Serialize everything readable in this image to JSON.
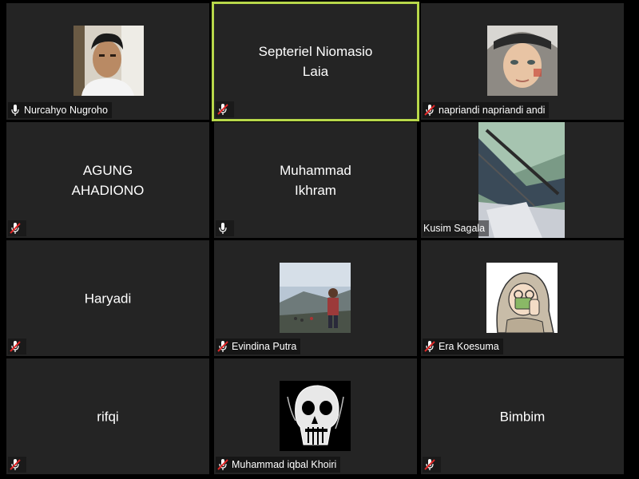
{
  "participants": [
    {
      "name": "Nurcahyo Nugroho",
      "muted": false,
      "video": "person-indoor"
    },
    {
      "name": "Septeriel Niomasio Laia",
      "display_lines": [
        "Septeriel Niomasio",
        "Laia"
      ],
      "muted": true,
      "active_speaker": true
    },
    {
      "name": "napriandi napriandi andi",
      "muted": true,
      "video": "child-scarf"
    },
    {
      "name": "AGUNG AHADIONO",
      "display_lines": [
        "AGUNG",
        "AHADIONO"
      ],
      "muted": true
    },
    {
      "name": "Muhammad Ikhram",
      "display_lines": [
        "Muhammad",
        "Ikhram"
      ],
      "muted": false
    },
    {
      "name": "Kusim Sagala",
      "muted": false,
      "video": "ceiling-view"
    },
    {
      "name": "Haryadi",
      "display_lines": [
        "Haryadi"
      ],
      "muted": true
    },
    {
      "name": "Evindina Putra",
      "muted": true,
      "video": "outdoor-mountain"
    },
    {
      "name": "Era Koesuma",
      "muted": true,
      "video": "cartoon-hijab"
    },
    {
      "name": "rifqi",
      "display_lines": [
        "rifqi"
      ],
      "muted": true
    },
    {
      "name": "Muhammad iqbal Khoiri",
      "muted": true,
      "video": "skull-art"
    },
    {
      "name": "Bimbim",
      "display_lines": [
        "Bimbim"
      ],
      "muted": true
    }
  ],
  "colors": {
    "background": "#000000",
    "tile": "#242424",
    "active_border": "#b8d84a",
    "muted_icon": "#e02828"
  }
}
